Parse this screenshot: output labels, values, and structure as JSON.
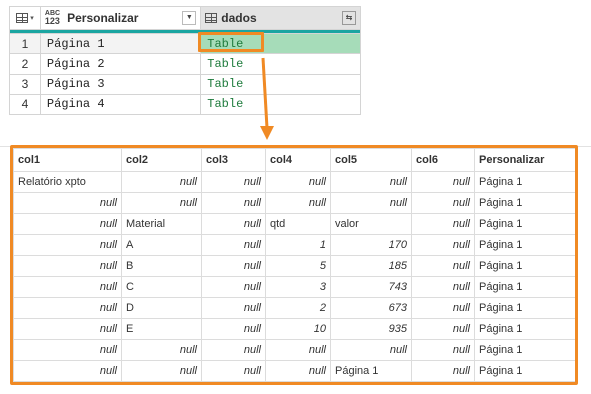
{
  "query_preview": {
    "columns": [
      {
        "label": "Personalizar",
        "type_badge_top": "ABC",
        "type_badge_bottom": "123"
      },
      {
        "label": "dados"
      }
    ],
    "rows": [
      {
        "num": "1",
        "personalizar": "Página 1",
        "dados": "Table"
      },
      {
        "num": "2",
        "personalizar": "Página 2",
        "dados": "Table"
      },
      {
        "num": "3",
        "personalizar": "Página 3",
        "dados": "Table"
      },
      {
        "num": "4",
        "personalizar": "Página 4",
        "dados": "Table"
      }
    ],
    "selected_row": 1
  },
  "expanded_table": {
    "headers": [
      "col1",
      "col2",
      "col3",
      "col4",
      "col5",
      "col6",
      "Personalizar"
    ],
    "rows": [
      [
        "Relatório xpto",
        "null",
        "null",
        "null",
        "null",
        "null",
        "Página 1"
      ],
      [
        "null",
        "null",
        "null",
        "null",
        "null",
        "null",
        "Página 1"
      ],
      [
        "null",
        "Material",
        "null",
        "qtd",
        "valor",
        "null",
        "Página 1"
      ],
      [
        "null",
        "A",
        "null",
        "1",
        "170",
        "null",
        "Página 1"
      ],
      [
        "null",
        "B",
        "null",
        "5",
        "185",
        "null",
        "Página 1"
      ],
      [
        "null",
        "C",
        "null",
        "3",
        "743",
        "null",
        "Página 1"
      ],
      [
        "null",
        "D",
        "null",
        "2",
        "673",
        "null",
        "Página 1"
      ],
      [
        "null",
        "E",
        "null",
        "10",
        "935",
        "null",
        "Página 1"
      ],
      [
        "null",
        "null",
        "null",
        "null",
        "null",
        "null",
        "Página 1"
      ],
      [
        "null",
        "null",
        "null",
        "null",
        "Página 1",
        "null",
        "Página 1"
      ]
    ]
  },
  "colors": {
    "accent_orange": "#f08a24",
    "teal_bar": "#1aa5a1",
    "selected_cell": "#a6dcb9",
    "table_text_green": "#1e7b3c"
  }
}
